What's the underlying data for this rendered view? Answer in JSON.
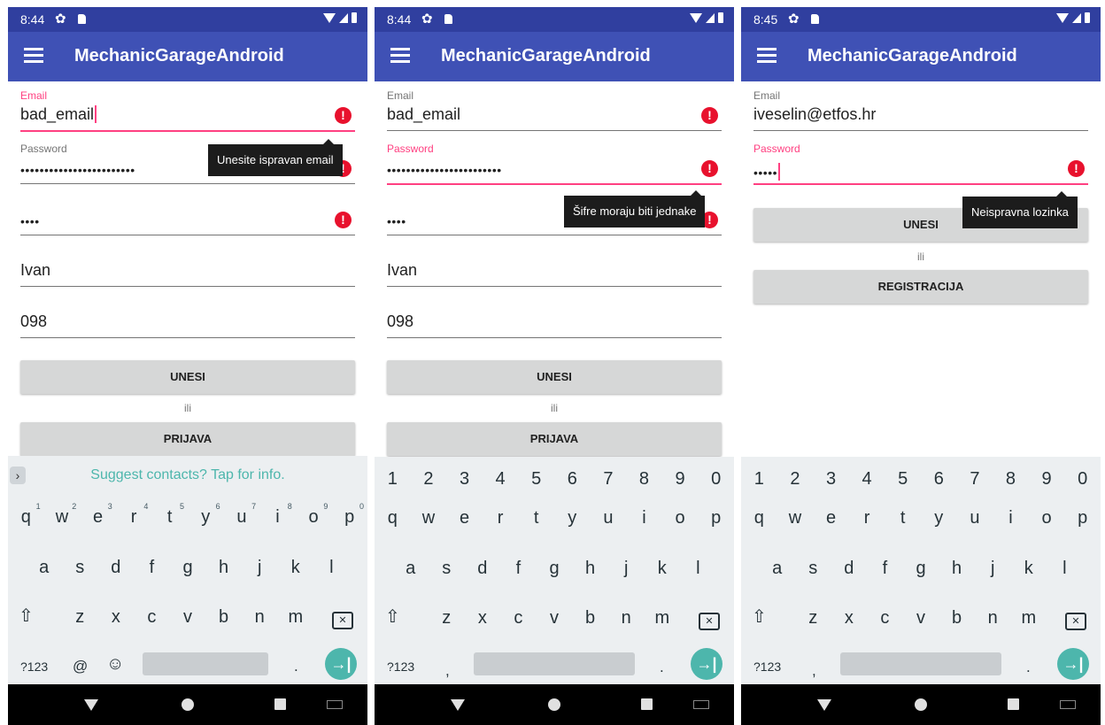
{
  "colors": {
    "primary": "#3F51B5",
    "primary_dark": "#303F9F",
    "accent": "#FF4081",
    "error": "#E8112D",
    "button": "#D6D7D7",
    "enter_key": "#4DB6AC"
  },
  "screens": [
    {
      "status": {
        "time": "8:44"
      },
      "app_title": "MechanicGarageAndroid",
      "fields": [
        {
          "label": "Email",
          "value": "bad_email"
        },
        {
          "label": "Password",
          "value": "••••••••••••••••••••••••"
        },
        {
          "label": "",
          "value": "••••"
        },
        {
          "label": "",
          "value": "Ivan"
        },
        {
          "label": "",
          "value": "098"
        }
      ],
      "tooltip": "Unesite ispravan email",
      "button_primary": "UNESI",
      "or_text": "ili",
      "button_secondary": "PRIJAVA",
      "keyboard": {
        "suggest": "Suggest contacts? Tap for info.",
        "row1": [
          "q",
          "w",
          "e",
          "r",
          "t",
          "y",
          "u",
          "i",
          "o",
          "p"
        ],
        "row1_sup": [
          "1",
          "2",
          "3",
          "4",
          "5",
          "6",
          "7",
          "8",
          "9",
          "0"
        ],
        "row2": [
          "a",
          "s",
          "d",
          "f",
          "g",
          "h",
          "j",
          "k",
          "l"
        ],
        "row3": [
          "z",
          "x",
          "c",
          "v",
          "b",
          "n",
          "m"
        ],
        "sym": "?123",
        "at": "@",
        "period": "."
      }
    },
    {
      "status": {
        "time": "8:44"
      },
      "app_title": "MechanicGarageAndroid",
      "fields": [
        {
          "label": "Email",
          "value": "bad_email"
        },
        {
          "label": "Password",
          "value": "••••••••••••••••••••••••"
        },
        {
          "label": "",
          "value": "••••"
        },
        {
          "label": "",
          "value": "Ivan"
        },
        {
          "label": "",
          "value": "098"
        }
      ],
      "tooltip": "Šifre moraju biti jednake",
      "button_primary": "UNESI",
      "or_text": "ili",
      "button_secondary": "PRIJAVA",
      "keyboard": {
        "numbers": [
          "1",
          "2",
          "3",
          "4",
          "5",
          "6",
          "7",
          "8",
          "9",
          "0"
        ],
        "row1": [
          "q",
          "w",
          "e",
          "r",
          "t",
          "y",
          "u",
          "i",
          "o",
          "p"
        ],
        "row2": [
          "a",
          "s",
          "d",
          "f",
          "g",
          "h",
          "j",
          "k",
          "l"
        ],
        "row3": [
          "z",
          "x",
          "c",
          "v",
          "b",
          "n",
          "m"
        ],
        "sym": "?123",
        "comma": ",",
        "period": "."
      }
    },
    {
      "status": {
        "time": "8:45"
      },
      "app_title": "MechanicGarageAndroid",
      "fields": [
        {
          "label": "Email",
          "value": "iveselin@etfos.hr"
        },
        {
          "label": "Password",
          "value": "•••••"
        }
      ],
      "tooltip": "Neispravna lozinka",
      "button_primary": "UNESI",
      "or_text": "ili",
      "button_secondary": "REGISTRACIJA",
      "keyboard": {
        "numbers": [
          "1",
          "2",
          "3",
          "4",
          "5",
          "6",
          "7",
          "8",
          "9",
          "0"
        ],
        "row1": [
          "q",
          "w",
          "e",
          "r",
          "t",
          "y",
          "u",
          "i",
          "o",
          "p"
        ],
        "row2": [
          "a",
          "s",
          "d",
          "f",
          "g",
          "h",
          "j",
          "k",
          "l"
        ],
        "row3": [
          "z",
          "x",
          "c",
          "v",
          "b",
          "n",
          "m"
        ],
        "sym": "?123",
        "comma": ",",
        "period": "."
      }
    }
  ]
}
